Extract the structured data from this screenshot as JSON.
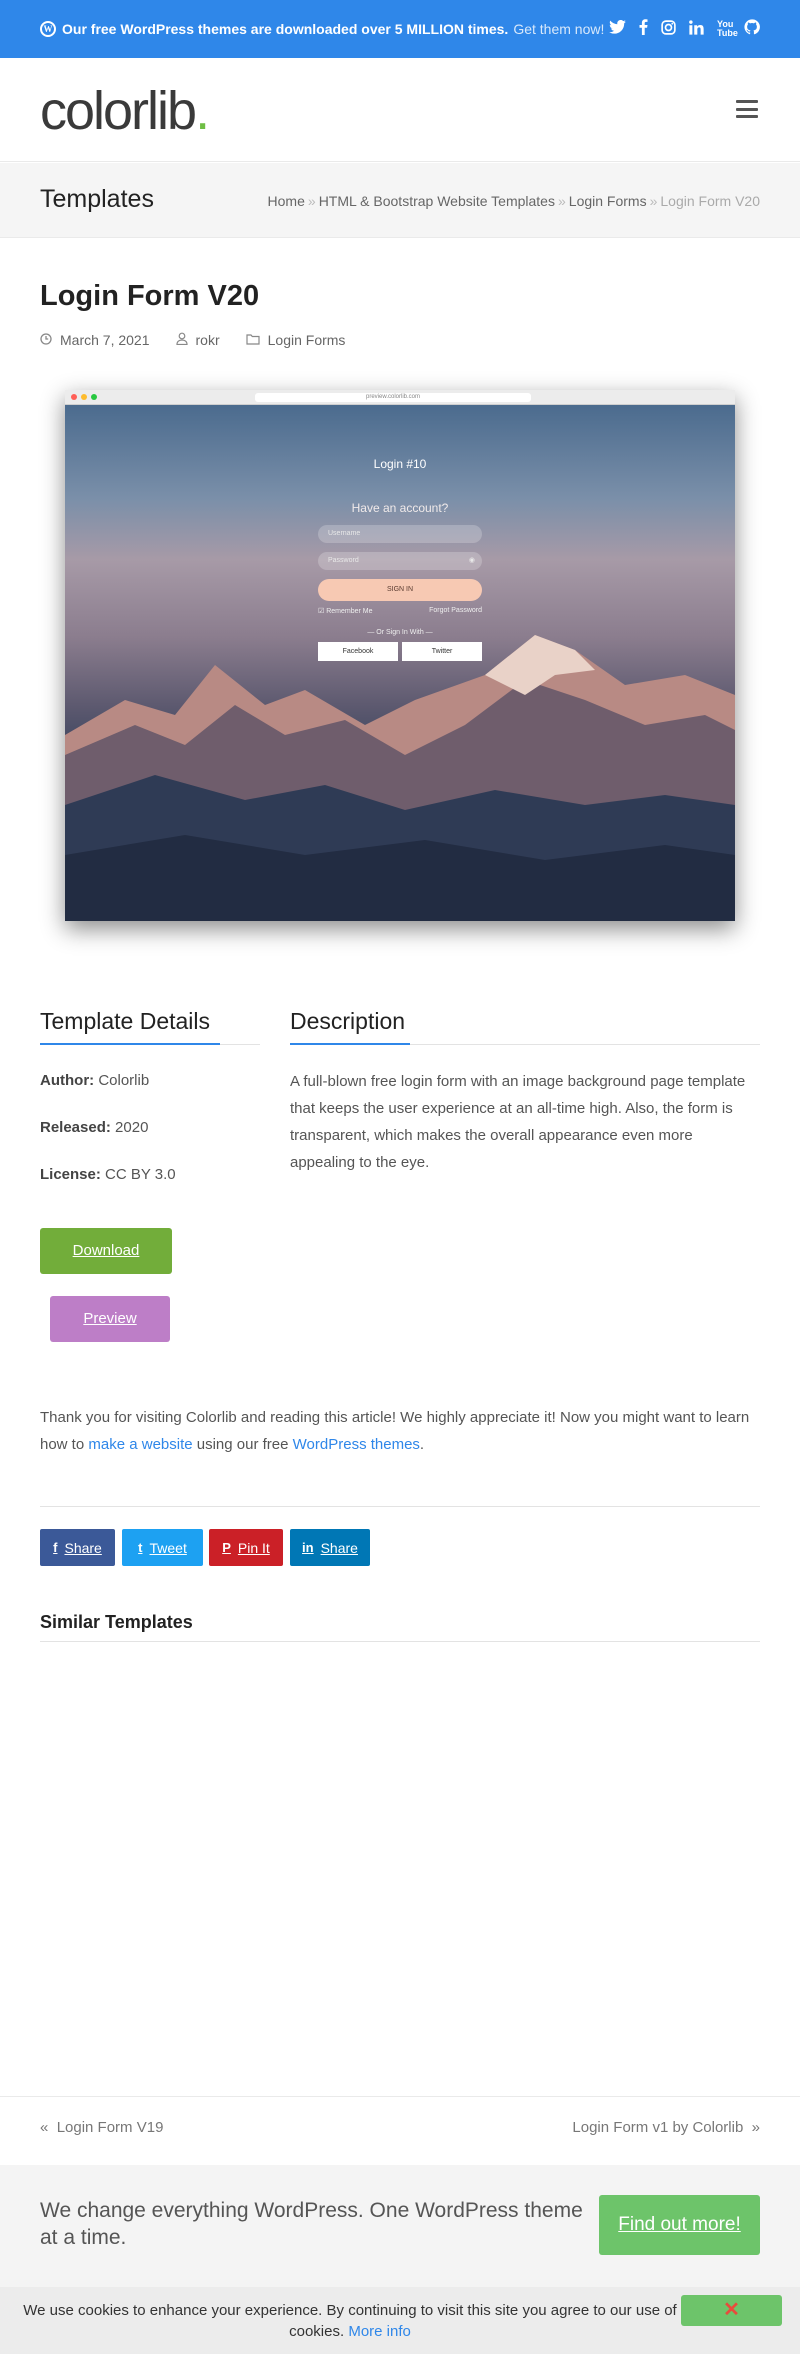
{
  "banner": {
    "message": "Our free WordPress themes are downloaded over 5 MILLION times.",
    "cta": "Get them now!",
    "social_icons": [
      "twitter-icon",
      "facebook-icon",
      "instagram-icon",
      "linkedin-icon",
      "youtube-icon",
      "github-icon"
    ],
    "youtube_text": "You Tube",
    "color": "#2f87e9"
  },
  "header": {
    "logo_text": "colorlib",
    "logo_dot": "."
  },
  "titlebar": {
    "title": "Templates",
    "breadcrumbs": [
      "Home",
      "HTML & Bootstrap Website Templates",
      "Login Forms"
    ],
    "breadcrumb_current": "Login Form V20",
    "separator": "»"
  },
  "post": {
    "title": "Login Form V20",
    "date": "March 7, 2021",
    "author": "rokr",
    "category": "Login Forms"
  },
  "preview": {
    "address": "preview.colorlib.com",
    "form_title": "Login #10",
    "subtitle": "Have an account?",
    "username_placeholder": "Username",
    "password_placeholder": "Password",
    "sign_in": "SIGN IN",
    "remember": "Remember Me",
    "forgot": "Forgot Password",
    "or_sign_in": "— Or Sign In With —",
    "facebook": "Facebook",
    "twitter": "Twitter"
  },
  "details": {
    "heading": "Template Details",
    "author_label": "Author:",
    "author_value": "Colorlib",
    "released_label": "Released:",
    "released_value": "2020",
    "license_label": "License:",
    "license_value": "CC BY 3.0",
    "download": "Download",
    "preview": "Preview"
  },
  "description": {
    "heading": "Description",
    "text": "A full-blown free login form with an image background page template that keeps the user experience at an all-time high. Also, the form is transparent, which makes the overall appearance even more appealing to the eye."
  },
  "thanks": {
    "prefix": "Thank you for visiting Colorlib and reading this article! We highly appreciate it! Now you might want to learn how to ",
    "link1": "make a website",
    "middle": " using our free ",
    "link2": "WordPress themes",
    "suffix": "."
  },
  "share": [
    {
      "label": "Share",
      "icon": "f",
      "color": "#3b5998"
    },
    {
      "label": "Tweet",
      "icon": "t",
      "color": "#1da1f2"
    },
    {
      "label": "Pin It",
      "icon": "P",
      "color": "#cb2027"
    },
    {
      "label": "Share",
      "icon": "in",
      "color": "#0077b5"
    }
  ],
  "similar": {
    "heading": "Similar Templates"
  },
  "postnav": {
    "prev": "Login Form V19",
    "next": "Login Form v1 by Colorlib"
  },
  "promo": {
    "text": "We change everything WordPress. One WordPress theme at a time.",
    "button": "Find out more!"
  },
  "cookie": {
    "text": "We use cookies to enhance your experience. By continuing to visit this site you agree to our use of cookies.",
    "more": "More info",
    "close": "✕"
  }
}
